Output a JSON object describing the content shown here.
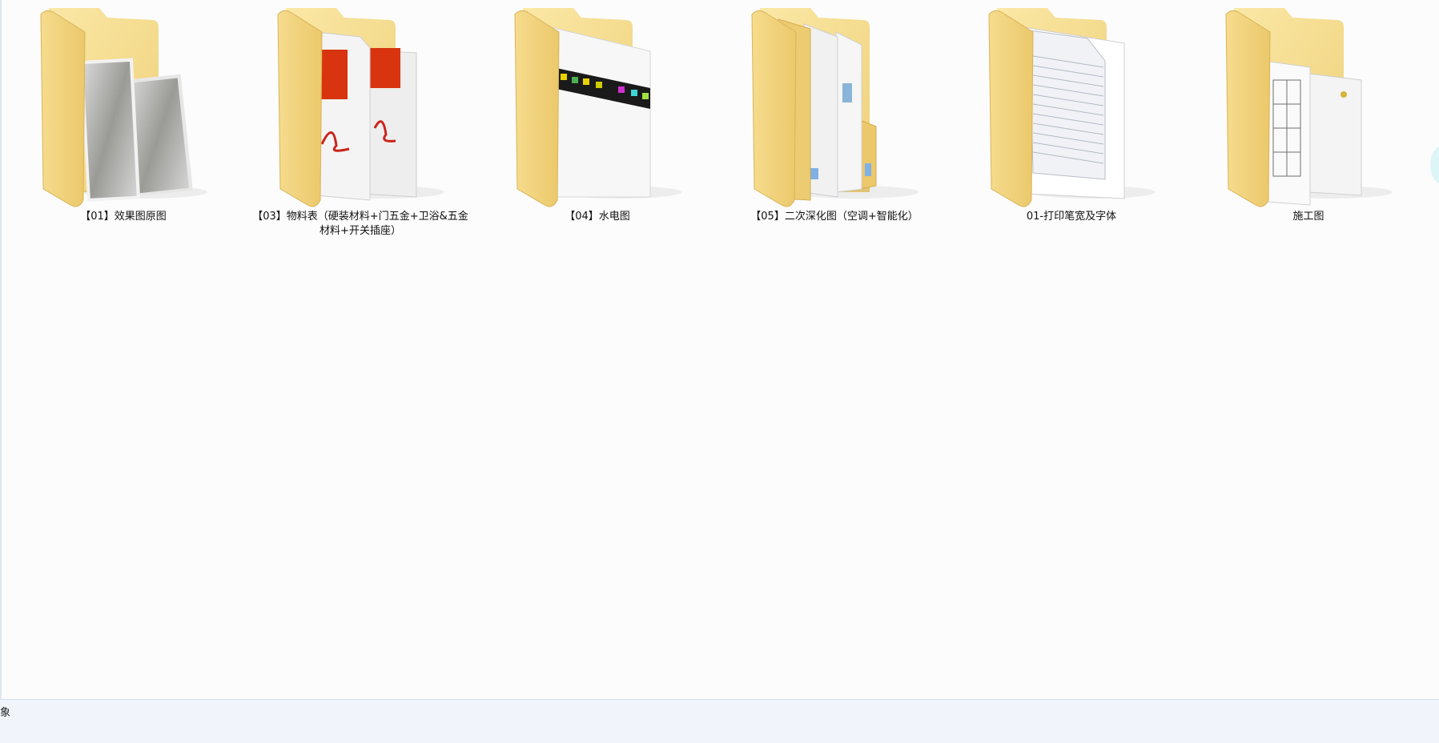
{
  "folders": [
    {
      "name": "【01】效果图原图",
      "preview": "photo"
    },
    {
      "name": "【03】物料表（硬装材料+门五金+卫浴&五金材料+开关插座）",
      "preview": "pdf"
    },
    {
      "name": "【04】水电图",
      "preview": "cad-strip"
    },
    {
      "name": "【05】二次深化图（空调+智能化）",
      "preview": "documents"
    },
    {
      "name": "01-打印笔宽及字体",
      "preview": "lined-paper"
    },
    {
      "name": "施工图",
      "preview": "drawings"
    }
  ],
  "status_bar": {
    "text": "象"
  },
  "colors": {
    "folder_front": "#f3d27e",
    "folder_back": "#f6dd93",
    "pdf_red": "#d8340f"
  }
}
